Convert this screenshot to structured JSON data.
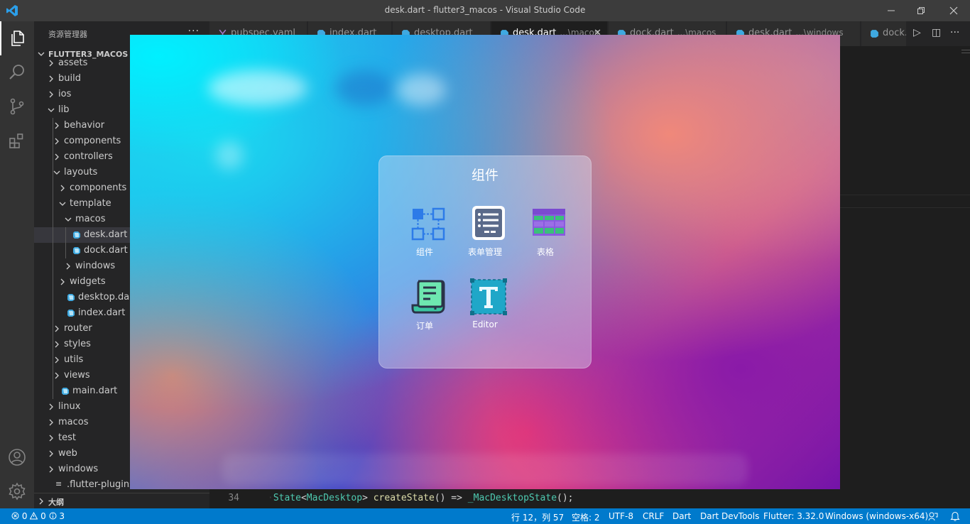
{
  "window": {
    "title": "desk.dart - flutter3_macos - Visual Studio Code"
  },
  "activity_bar": {
    "items": [
      "explorer-icon",
      "search-icon",
      "source-control-icon",
      "extensions-icon"
    ],
    "bottom": [
      "account-icon",
      "settings-icon"
    ]
  },
  "sidebar": {
    "header": "资源管理器",
    "more": "···",
    "root": "FLUTTER3_MACOS",
    "tree": [
      {
        "label": "assets",
        "depth": 0,
        "type": "folder",
        "open": false
      },
      {
        "label": "build",
        "depth": 0,
        "type": "folder",
        "open": false
      },
      {
        "label": "ios",
        "depth": 0,
        "type": "folder",
        "open": false
      },
      {
        "label": "lib",
        "depth": 0,
        "type": "folder",
        "open": true
      },
      {
        "label": "behavior",
        "depth": 1,
        "type": "folder",
        "open": false
      },
      {
        "label": "components",
        "depth": 1,
        "type": "folder",
        "open": false
      },
      {
        "label": "controllers",
        "depth": 1,
        "type": "folder",
        "open": false
      },
      {
        "label": "layouts",
        "depth": 1,
        "type": "folder",
        "open": true
      },
      {
        "label": "components",
        "depth": 2,
        "type": "folder",
        "open": false
      },
      {
        "label": "template",
        "depth": 2,
        "type": "folder",
        "open": true
      },
      {
        "label": "macos",
        "depth": 3,
        "type": "folder",
        "open": true
      },
      {
        "label": "desk.dart",
        "depth": 4,
        "type": "dart",
        "selected": true
      },
      {
        "label": "dock.dart",
        "depth": 4,
        "type": "dart"
      },
      {
        "label": "windows",
        "depth": 3,
        "type": "folder",
        "open": false
      },
      {
        "label": "widgets",
        "depth": 2,
        "type": "folder",
        "open": false
      },
      {
        "label": "desktop.dart",
        "depth": 3,
        "type": "dart"
      },
      {
        "label": "index.dart",
        "depth": 3,
        "type": "dart"
      },
      {
        "label": "router",
        "depth": 1,
        "type": "folder",
        "open": false
      },
      {
        "label": "styles",
        "depth": 1,
        "type": "folder",
        "open": false
      },
      {
        "label": "utils",
        "depth": 1,
        "type": "folder",
        "open": false
      },
      {
        "label": "views",
        "depth": 1,
        "type": "folder",
        "open": false
      },
      {
        "label": "main.dart",
        "depth": 2,
        "type": "dart"
      },
      {
        "label": "linux",
        "depth": 0,
        "type": "folder",
        "open": false
      },
      {
        "label": "macos",
        "depth": 0,
        "type": "folder",
        "open": false
      },
      {
        "label": "test",
        "depth": 0,
        "type": "folder",
        "open": false
      },
      {
        "label": "web",
        "depth": 0,
        "type": "folder",
        "open": false
      },
      {
        "label": "windows",
        "depth": 0,
        "type": "folder",
        "open": false
      },
      {
        "label": ".flutter-plugins-dep",
        "depth": 1,
        "type": "file"
      }
    ],
    "outline": "大纲"
  },
  "tabs": [
    {
      "name": "pubspec.yaml",
      "sub": "",
      "active": false
    },
    {
      "name": "index.dart",
      "sub": "",
      "active": false
    },
    {
      "name": "desktop.dart",
      "sub": "",
      "active": false
    },
    {
      "name": "desk.dart",
      "sub": "...\\macos",
      "active": true
    },
    {
      "name": "dock.dart",
      "sub": "...\\macos",
      "active": false
    },
    {
      "name": "desk.dart",
      "sub": "...\\windows",
      "active": false
    },
    {
      "name": "dock.dart",
      "sub": "",
      "active": false
    }
  ],
  "tab_actions": [
    "run-icon",
    "split-editor-icon",
    "more-icon"
  ],
  "code": {
    "line_number": "34",
    "tokens": [
      {
        "t": "State",
        "c": "type"
      },
      {
        "t": "<",
        "c": "punc"
      },
      {
        "t": "MacDesktop",
        "c": "type"
      },
      {
        "t": "> ",
        "c": "punc"
      },
      {
        "t": "createState",
        "c": "fn"
      },
      {
        "t": "() => ",
        "c": "punc"
      },
      {
        "t": "_MacDesktopState",
        "c": "type"
      },
      {
        "t": "();",
        "c": "punc"
      }
    ]
  },
  "app_window": {
    "panel_title": "组件",
    "apps": [
      {
        "label": "组件",
        "icon": "components-icon"
      },
      {
        "label": "表单管理",
        "icon": "form-icon"
      },
      {
        "label": "表格",
        "icon": "table-icon"
      },
      {
        "label": "订单",
        "icon": "order-icon"
      },
      {
        "label": "Editor",
        "icon": "editor-icon"
      }
    ]
  },
  "statusbar": {
    "errors": "0",
    "warnings": "0",
    "info": "3",
    "position": "行 12，列 57",
    "spaces": "空格: 2",
    "encoding": "UTF-8",
    "eol": "CRLF",
    "language": "Dart",
    "devtools": "Dart DevTools",
    "flutter": "Flutter: 3.32.0",
    "device": "Windows (windows-x64)"
  },
  "colors": {
    "statusbar": "#007acc",
    "titlebar": "#3c3c3c",
    "sidebar": "#252526",
    "editor": "#1e1e1e",
    "activitybar": "#333333"
  }
}
